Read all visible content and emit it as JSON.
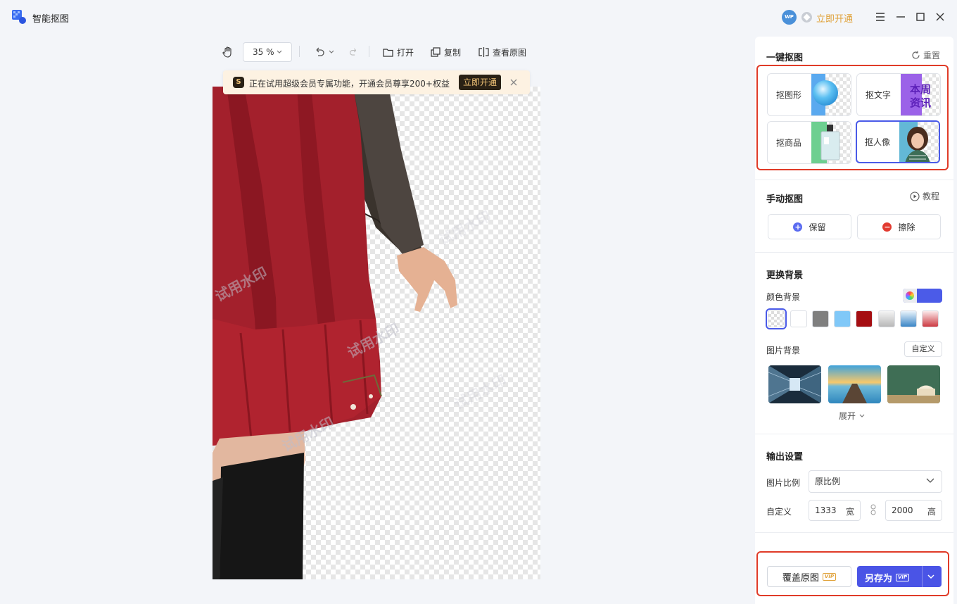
{
  "app": {
    "title": "智能抠图",
    "avatar_text": "WP",
    "upgrade_label": "立即开通"
  },
  "toolbar": {
    "zoom": "35 %",
    "open_label": "打开",
    "copy_label": "复制",
    "view_original_label": "查看原图"
  },
  "banner": {
    "text": "正在试用超级会员专属功能，开通会员尊享200+权益",
    "button": "立即开通"
  },
  "canvas": {
    "watermark": "试用水印"
  },
  "panel": {
    "one_click": {
      "title": "一键抠图",
      "reset_label": "重置",
      "cards": [
        {
          "label": "抠图形",
          "thumb": "sphere"
        },
        {
          "label": "抠文字",
          "thumb_text": [
            "本周",
            "资讯"
          ]
        },
        {
          "label": "抠商品",
          "thumb": "bottle"
        },
        {
          "label": "抠人像",
          "thumb": "portrait",
          "selected": true
        }
      ]
    },
    "manual": {
      "title": "手动抠图",
      "tutorial_label": "教程",
      "keep_label": "保留",
      "erase_label": "擦除"
    },
    "background": {
      "title": "更换背景",
      "color_label": "颜色背景",
      "swatches": [
        "transparent",
        "#ffffff",
        "#7f7f7f",
        "#80c8f8",
        "#a50e12",
        "gradient-gray",
        "gradient-blue",
        "gradient-red"
      ],
      "image_label": "图片背景",
      "custom_label": "自定义",
      "expand_label": "展开"
    },
    "output": {
      "title": "输出设置",
      "ratio_label": "图片比例",
      "ratio_value": "原比例",
      "custom_label": "自定义",
      "width": "1333",
      "width_unit": "宽",
      "height": "2000",
      "height_unit": "高"
    },
    "actions": {
      "overwrite_label": "覆盖原图",
      "saveas_label": "另存为",
      "vip": "VIP"
    }
  },
  "colors": {
    "accent": "#4a54e6",
    "highlight_box": "#e03b28",
    "gold": "#e0a23a"
  }
}
